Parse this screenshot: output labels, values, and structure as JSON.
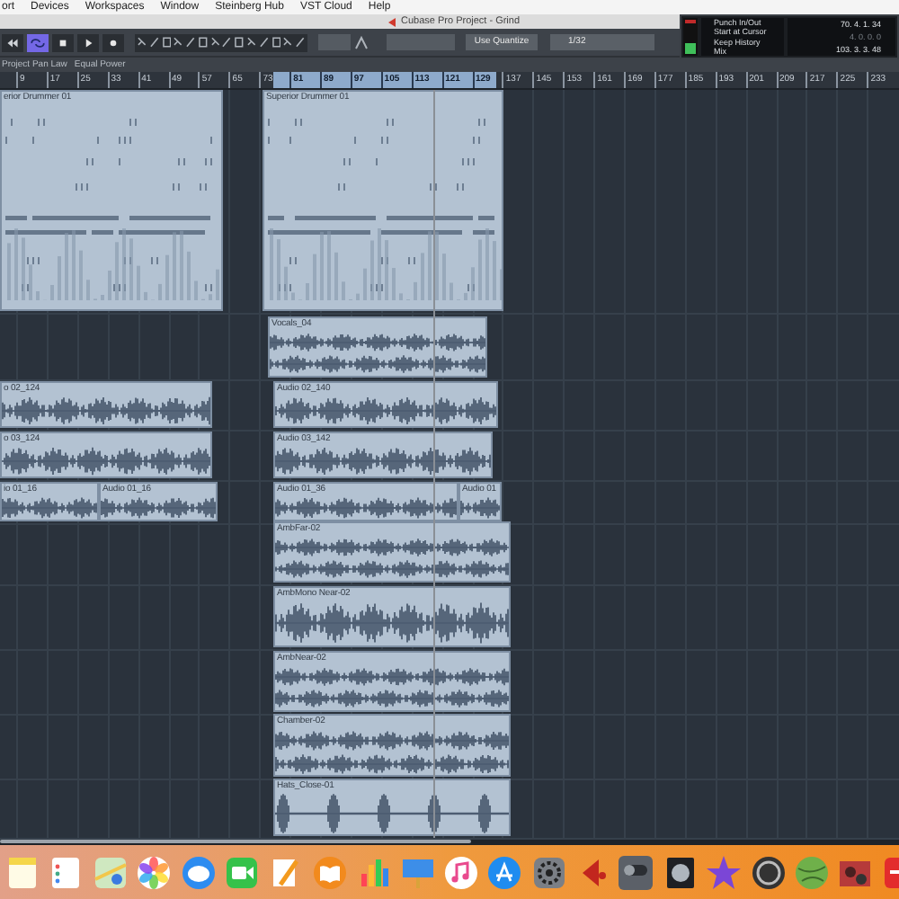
{
  "menu_bar": [
    "ort",
    "Devices",
    "Workspaces",
    "Window",
    "Steinberg Hub",
    "VST Cloud",
    "Help"
  ],
  "window": {
    "title": "Cubase Pro Project - Grind"
  },
  "toolbar": {
    "transport": [
      {
        "kind": "rewind",
        "on": false
      },
      {
        "kind": "cycle",
        "on": true
      },
      {
        "kind": "stop",
        "on": false
      },
      {
        "kind": "play",
        "on": false
      },
      {
        "kind": "record",
        "on": false
      }
    ],
    "quantize_mode": "Use Quantize",
    "quantize_value": "1/32"
  },
  "info_line": [
    "Project Pan Law",
    "Equal Power"
  ],
  "transport_panel": {
    "options": [
      "Punch In/Out",
      "Start at Cursor",
      "Keep History",
      "Mix"
    ],
    "positions": [
      "70. 4. 1. 34",
      "4. 0. 0. 0",
      "103. 3. 3. 48"
    ]
  },
  "ruler": [
    "9",
    "17",
    "25",
    "33",
    "41",
    "49",
    "57",
    "65",
    "73",
    "81",
    "89",
    "97",
    "105",
    "113",
    "121",
    "129",
    "137",
    "145",
    "153",
    "161",
    "169",
    "177",
    "185",
    "193",
    "201",
    "209",
    "217",
    "225",
    "233"
  ],
  "tracks": [
    {
      "clips": [
        {
          "name": "erior Drummer 01",
          "kind": "midi"
        },
        {
          "name": "Superior Drummer 01",
          "kind": "midi"
        }
      ]
    },
    {
      "clips": [
        {
          "name": "Vocals_04",
          "kind": "stereo"
        }
      ]
    },
    {
      "clips": [
        {
          "name": "o 02_124",
          "kind": "mono"
        },
        {
          "name": "Audio 02_140",
          "kind": "mono"
        }
      ]
    },
    {
      "clips": [
        {
          "name": "o 03_124",
          "kind": "mono"
        },
        {
          "name": "Audio 03_142",
          "kind": "mono"
        }
      ]
    },
    {
      "clips": [
        {
          "name": "io 01_16",
          "kind": "mono"
        },
        {
          "name": "Audio 01_16",
          "kind": "mono"
        },
        {
          "name": "Audio 01_36",
          "kind": "mono"
        },
        {
          "name": "Audio 01",
          "kind": "mono"
        }
      ]
    },
    {
      "clips": [
        {
          "name": "AmbFar-02",
          "kind": "stereo"
        }
      ]
    },
    {
      "clips": [
        {
          "name": "AmbMono Near-02",
          "kind": "mono"
        }
      ]
    },
    {
      "clips": [
        {
          "name": "AmbNear-02",
          "kind": "stereo"
        }
      ]
    },
    {
      "clips": [
        {
          "name": "Chamber-02",
          "kind": "stereo"
        }
      ]
    },
    {
      "clips": [
        {
          "name": "Hats_Close-01",
          "kind": "hits"
        }
      ]
    }
  ]
}
